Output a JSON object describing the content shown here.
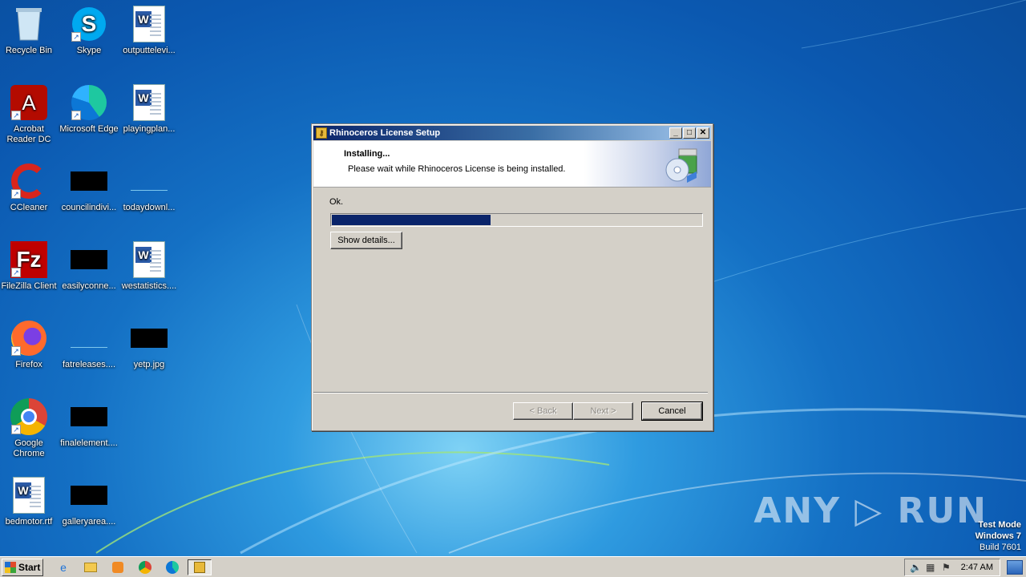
{
  "desktop": {
    "icons": [
      {
        "label": "Recycle Bin",
        "icon": "recycle-bin-icon"
      },
      {
        "label": "Skype",
        "icon": "skype-icon"
      },
      {
        "label": "outputtelevi...",
        "icon": "word-document-icon"
      },
      {
        "label": "Acrobat Reader DC",
        "icon": "acrobat-reader-icon"
      },
      {
        "label": "Microsoft Edge",
        "icon": "edge-icon"
      },
      {
        "label": "playingplan...",
        "icon": "word-document-icon"
      },
      {
        "label": "CCleaner",
        "icon": "ccleaner-icon"
      },
      {
        "label": "councilindivi...",
        "icon": "image-thumbnail-icon"
      },
      {
        "label": "todaydownl...",
        "icon": "image-thumbnail-icon"
      },
      {
        "label": "FileZilla Client",
        "icon": "filezilla-icon"
      },
      {
        "label": "easilyconne...",
        "icon": "image-thumbnail-icon"
      },
      {
        "label": "westatistics....",
        "icon": "word-document-icon"
      },
      {
        "label": "Firefox",
        "icon": "firefox-icon"
      },
      {
        "label": "fatreleases....",
        "icon": "image-thumbnail-icon"
      },
      {
        "label": "yetp.jpg",
        "icon": "image-thumbnail-icon"
      },
      {
        "label": "Google Chrome",
        "icon": "chrome-icon"
      },
      {
        "label": "finalelement....",
        "icon": "image-thumbnail-icon"
      },
      {
        "label": "bedmotor.rtf",
        "icon": "word-document-icon"
      },
      {
        "label": "galleryarea....",
        "icon": "image-thumbnail-icon"
      }
    ]
  },
  "dialog": {
    "title": "Rhinoceros License Setup",
    "header_title": "Installing...",
    "header_subtitle": "Please wait while Rhinoceros License is being installed.",
    "status": "Ok.",
    "progress_fraction": 0.43,
    "show_details_label": "Show details...",
    "back_label": "< Back",
    "next_label": "Next >",
    "cancel_label": "Cancel",
    "colors": {
      "progress": "#0a246a",
      "titlebar": "#0a246a"
    }
  },
  "watermark": {
    "text": "ANY ▷ RUN"
  },
  "os_info": {
    "line1": "Test Mode",
    "line2": "Windows 7",
    "line3": "Build 7601"
  },
  "taskbar": {
    "start_label": "Start",
    "items": [
      "internet-explorer-icon",
      "explorer-icon",
      "media-player-icon",
      "chrome-icon",
      "edge-icon",
      "setup-icon"
    ],
    "clock": "2:47 AM"
  }
}
